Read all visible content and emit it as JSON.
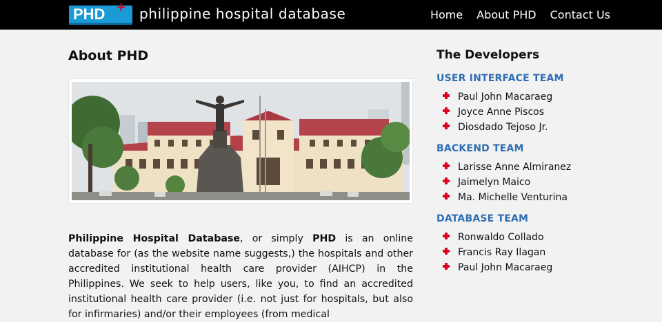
{
  "header": {
    "logo_text": "PHD",
    "logo_plus": "+",
    "site_title": "philippine hospital database",
    "nav": [
      "Home",
      "About PHD",
      "Contact Us"
    ]
  },
  "main": {
    "title": "About PHD",
    "intro": {
      "bold_name": "Philippine Hospital Database",
      "text_1": ", or simply ",
      "bold_short": "PHD",
      "text_2": " is an online database for (as the website name suggests,) the hospitals and other accredited institutional health care provider (AIHCP) in the Philippines. We seek to help users, like you, to find an accredited institutional health care provider (i.e. not just for hospitals, but also for infirmaries) and/or their employees (from medical"
    }
  },
  "sidebar": {
    "title": "The Developers",
    "teams": [
      {
        "name": "USER INTERFACE TEAM",
        "members": [
          "Paul John Macaraeg",
          "Joyce Anne Piscos",
          "Diosdado Tejoso Jr."
        ]
      },
      {
        "name": "BACKEND TEAM",
        "members": [
          "Larisse Anne Almiranez",
          "Jaimelyn Maico",
          "Ma. Michelle Venturina"
        ]
      },
      {
        "name": "DATABASE TEAM",
        "members": [
          "Ronwaldo Collado",
          "Francis Ray Ilagan",
          "Paul John Macaraeg"
        ]
      }
    ]
  },
  "colors": {
    "topbar": "#000000",
    "logo_blue": "#1a9ad6",
    "accent_red": "#e0001b",
    "team_heading": "#2e6fb3",
    "page_bg": "#f2f2f2"
  }
}
